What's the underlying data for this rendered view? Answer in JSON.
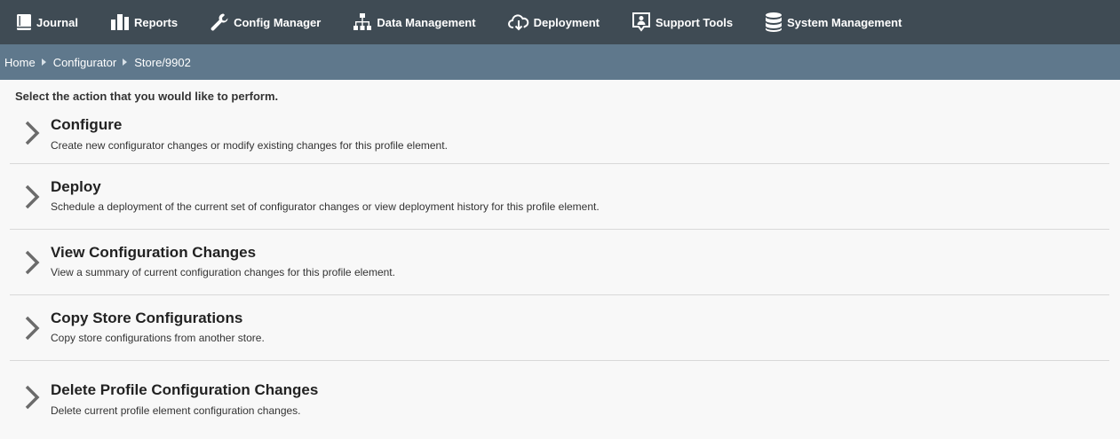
{
  "topnav": {
    "items": [
      {
        "label": "Journal",
        "icon": "journal-icon"
      },
      {
        "label": "Reports",
        "icon": "bar-chart-icon"
      },
      {
        "label": "Config Manager",
        "icon": "wrench-icon"
      },
      {
        "label": "Data Management",
        "icon": "hierarchy-icon"
      },
      {
        "label": "Deployment",
        "icon": "cloud-download-icon"
      },
      {
        "label": "Support Tools",
        "icon": "support-person-icon"
      },
      {
        "label": "System Management",
        "icon": "database-icon"
      }
    ]
  },
  "breadcrumb": {
    "items": [
      "Home",
      "Configurator",
      "Store/9902"
    ]
  },
  "main": {
    "instructions": "Select the action that you would like to perform.",
    "actions": [
      {
        "title": "Configure",
        "description": "Create new configurator changes or modify existing changes for this profile element."
      },
      {
        "title": "Deploy",
        "description": "Schedule a deployment of the current set of configurator changes or view deployment history for this profile element."
      },
      {
        "title": "View Configuration Changes",
        "description": "View a summary of current configuration changes for this profile element."
      },
      {
        "title": "Copy Store Configurations",
        "description": "Copy store configurations from another store."
      },
      {
        "title": "Delete Profile Configuration Changes",
        "description": "Delete current profile element configuration changes."
      }
    ]
  },
  "colors": {
    "topnav_bg": "#3f4b54",
    "breadcrumb_bg": "#5f788c",
    "page_bg": "#f8f8f8",
    "chevron": "#6b6b6b"
  }
}
